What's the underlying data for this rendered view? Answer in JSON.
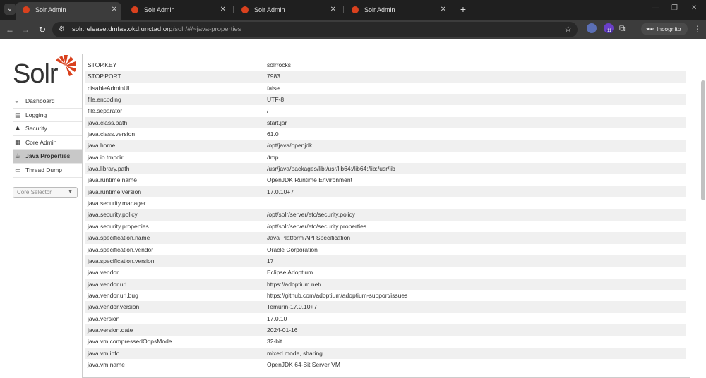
{
  "browser": {
    "tabs": [
      {
        "title": "Solr Admin",
        "active": true
      },
      {
        "title": "Solr Admin",
        "active": false
      },
      {
        "title": "Solr Admin",
        "active": false
      },
      {
        "title": "Solr Admin",
        "active": false
      }
    ],
    "url": {
      "host": "solr.release.dmfas.okd.unctad.org",
      "path": "/solr/#/~java-properties"
    },
    "incognito_label": "Incognito",
    "extension_badge": "11"
  },
  "logo": {
    "text": "Solr",
    "accent": "#d9411e"
  },
  "sidebar": {
    "items": [
      {
        "label": "Dashboard",
        "icon": "dashboard-icon",
        "active": false
      },
      {
        "label": "Logging",
        "icon": "logging-icon",
        "active": false
      },
      {
        "label": "Security",
        "icon": "security-icon",
        "active": false
      },
      {
        "label": "Core Admin",
        "icon": "core-admin-icon",
        "active": false
      },
      {
        "label": "Java Properties",
        "icon": "java-icon",
        "active": true
      },
      {
        "label": "Thread Dump",
        "icon": "thread-dump-icon",
        "active": false
      }
    ],
    "core_selector": {
      "placeholder": "Core Selector"
    }
  },
  "properties": [
    {
      "key": "STOP.KEY",
      "value": "solrrocks"
    },
    {
      "key": "STOP.PORT",
      "value": "7983"
    },
    {
      "key": "disableAdminUI",
      "value": "false"
    },
    {
      "key": "file.encoding",
      "value": "UTF-8"
    },
    {
      "key": "file.separator",
      "value": "/"
    },
    {
      "key": "java.class.path",
      "value": "start.jar"
    },
    {
      "key": "java.class.version",
      "value": "61.0"
    },
    {
      "key": "java.home",
      "value": "/opt/java/openjdk"
    },
    {
      "key": "java.io.tmpdir",
      "value": "/tmp"
    },
    {
      "key": "java.library.path",
      "value": "/usr/java/packages/lib:/usr/lib64:/lib64:/lib:/usr/lib"
    },
    {
      "key": "java.runtime.name",
      "value": "OpenJDK Runtime Environment"
    },
    {
      "key": "java.runtime.version",
      "value": "17.0.10+7"
    },
    {
      "key": "java.security.manager",
      "value": ""
    },
    {
      "key": "java.security.policy",
      "value": "/opt/solr/server/etc/security.policy"
    },
    {
      "key": "java.security.properties",
      "value": "/opt/solr/server/etc/security.properties"
    },
    {
      "key": "java.specification.name",
      "value": "Java Platform API Specification"
    },
    {
      "key": "java.specification.vendor",
      "value": "Oracle Corporation"
    },
    {
      "key": "java.specification.version",
      "value": "17"
    },
    {
      "key": "java.vendor",
      "value": "Eclipse Adoptium"
    },
    {
      "key": "java.vendor.url",
      "value": "https://adoptium.net/"
    },
    {
      "key": "java.vendor.url.bug",
      "value": "https://github.com/adoptium/adoptium-support/issues"
    },
    {
      "key": "java.vendor.version",
      "value": "Temurin-17.0.10+7"
    },
    {
      "key": "java.version",
      "value": "17.0.10"
    },
    {
      "key": "java.version.date",
      "value": "2024-01-16"
    },
    {
      "key": "java.vm.compressedOopsMode",
      "value": "32-bit"
    },
    {
      "key": "java.vm.info",
      "value": "mixed mode, sharing"
    },
    {
      "key": "java.vm.name",
      "value": "OpenJDK 64-Bit Server VM"
    }
  ]
}
